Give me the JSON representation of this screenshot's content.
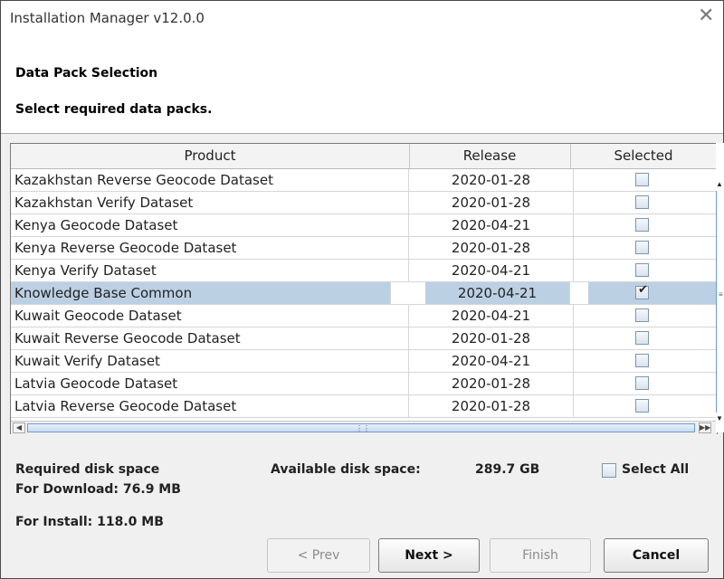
{
  "window": {
    "title": "Installation Manager v12.0.0",
    "close_glyph": "✕"
  },
  "header": {
    "section_title": "Data Pack Selection",
    "instruction": "Select required data packs."
  },
  "table": {
    "columns": [
      "Product",
      "Release",
      "Selected"
    ],
    "rows": [
      {
        "product": "Kazakhstan Reverse Geocode Dataset",
        "release": "2020-01-28",
        "selected": false
      },
      {
        "product": "Kazakhstan Verify Dataset",
        "release": "2020-01-28",
        "selected": false
      },
      {
        "product": "Kenya Geocode Dataset",
        "release": "2020-04-21",
        "selected": false
      },
      {
        "product": "Kenya Reverse Geocode Dataset",
        "release": "2020-01-28",
        "selected": false
      },
      {
        "product": "Kenya Verify Dataset",
        "release": "2020-04-21",
        "selected": false
      },
      {
        "product": "Knowledge Base Common",
        "release": "2020-04-21",
        "selected": true
      },
      {
        "product": "Kuwait Geocode Dataset",
        "release": "2020-04-21",
        "selected": false
      },
      {
        "product": "Kuwait Reverse Geocode Dataset",
        "release": "2020-01-28",
        "selected": false
      },
      {
        "product": "Kuwait Verify Dataset",
        "release": "2020-04-21",
        "selected": false
      },
      {
        "product": "Latvia Geocode Dataset",
        "release": "2020-01-28",
        "selected": false
      },
      {
        "product": "Latvia Reverse Geocode Dataset",
        "release": "2020-01-28",
        "selected": false
      }
    ]
  },
  "footer": {
    "required_label": "Required disk space",
    "download_label": "For Download: 76.9 MB",
    "install_label": "For Install: 118.0 MB",
    "available_label": "Available disk space:",
    "available_value": "289.7 GB",
    "select_all_label": "Select All"
  },
  "buttons": {
    "prev": "< Prev",
    "next": "Next >",
    "finish": "Finish",
    "cancel": "Cancel"
  },
  "colors": {
    "selection": "#bcd0e4",
    "scroll_accent": "#6f9bd1"
  }
}
